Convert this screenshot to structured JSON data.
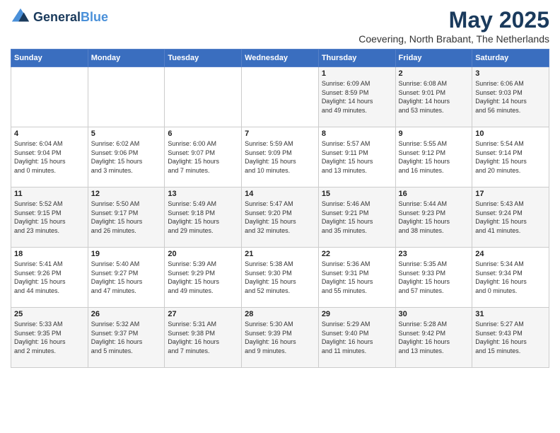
{
  "header": {
    "logo_general": "General",
    "logo_blue": "Blue",
    "month_year": "May 2025",
    "location": "Coevering, North Brabant, The Netherlands"
  },
  "weekdays": [
    "Sunday",
    "Monday",
    "Tuesday",
    "Wednesday",
    "Thursday",
    "Friday",
    "Saturday"
  ],
  "weeks": [
    [
      {
        "day": "",
        "info": ""
      },
      {
        "day": "",
        "info": ""
      },
      {
        "day": "",
        "info": ""
      },
      {
        "day": "",
        "info": ""
      },
      {
        "day": "1",
        "info": "Sunrise: 6:09 AM\nSunset: 8:59 PM\nDaylight: 14 hours\nand 49 minutes."
      },
      {
        "day": "2",
        "info": "Sunrise: 6:08 AM\nSunset: 9:01 PM\nDaylight: 14 hours\nand 53 minutes."
      },
      {
        "day": "3",
        "info": "Sunrise: 6:06 AM\nSunset: 9:03 PM\nDaylight: 14 hours\nand 56 minutes."
      }
    ],
    [
      {
        "day": "4",
        "info": "Sunrise: 6:04 AM\nSunset: 9:04 PM\nDaylight: 15 hours\nand 0 minutes."
      },
      {
        "day": "5",
        "info": "Sunrise: 6:02 AM\nSunset: 9:06 PM\nDaylight: 15 hours\nand 3 minutes."
      },
      {
        "day": "6",
        "info": "Sunrise: 6:00 AM\nSunset: 9:07 PM\nDaylight: 15 hours\nand 7 minutes."
      },
      {
        "day": "7",
        "info": "Sunrise: 5:59 AM\nSunset: 9:09 PM\nDaylight: 15 hours\nand 10 minutes."
      },
      {
        "day": "8",
        "info": "Sunrise: 5:57 AM\nSunset: 9:11 PM\nDaylight: 15 hours\nand 13 minutes."
      },
      {
        "day": "9",
        "info": "Sunrise: 5:55 AM\nSunset: 9:12 PM\nDaylight: 15 hours\nand 16 minutes."
      },
      {
        "day": "10",
        "info": "Sunrise: 5:54 AM\nSunset: 9:14 PM\nDaylight: 15 hours\nand 20 minutes."
      }
    ],
    [
      {
        "day": "11",
        "info": "Sunrise: 5:52 AM\nSunset: 9:15 PM\nDaylight: 15 hours\nand 23 minutes."
      },
      {
        "day": "12",
        "info": "Sunrise: 5:50 AM\nSunset: 9:17 PM\nDaylight: 15 hours\nand 26 minutes."
      },
      {
        "day": "13",
        "info": "Sunrise: 5:49 AM\nSunset: 9:18 PM\nDaylight: 15 hours\nand 29 minutes."
      },
      {
        "day": "14",
        "info": "Sunrise: 5:47 AM\nSunset: 9:20 PM\nDaylight: 15 hours\nand 32 minutes."
      },
      {
        "day": "15",
        "info": "Sunrise: 5:46 AM\nSunset: 9:21 PM\nDaylight: 15 hours\nand 35 minutes."
      },
      {
        "day": "16",
        "info": "Sunrise: 5:44 AM\nSunset: 9:23 PM\nDaylight: 15 hours\nand 38 minutes."
      },
      {
        "day": "17",
        "info": "Sunrise: 5:43 AM\nSunset: 9:24 PM\nDaylight: 15 hours\nand 41 minutes."
      }
    ],
    [
      {
        "day": "18",
        "info": "Sunrise: 5:41 AM\nSunset: 9:26 PM\nDaylight: 15 hours\nand 44 minutes."
      },
      {
        "day": "19",
        "info": "Sunrise: 5:40 AM\nSunset: 9:27 PM\nDaylight: 15 hours\nand 47 minutes."
      },
      {
        "day": "20",
        "info": "Sunrise: 5:39 AM\nSunset: 9:29 PM\nDaylight: 15 hours\nand 49 minutes."
      },
      {
        "day": "21",
        "info": "Sunrise: 5:38 AM\nSunset: 9:30 PM\nDaylight: 15 hours\nand 52 minutes."
      },
      {
        "day": "22",
        "info": "Sunrise: 5:36 AM\nSunset: 9:31 PM\nDaylight: 15 hours\nand 55 minutes."
      },
      {
        "day": "23",
        "info": "Sunrise: 5:35 AM\nSunset: 9:33 PM\nDaylight: 15 hours\nand 57 minutes."
      },
      {
        "day": "24",
        "info": "Sunrise: 5:34 AM\nSunset: 9:34 PM\nDaylight: 16 hours\nand 0 minutes."
      }
    ],
    [
      {
        "day": "25",
        "info": "Sunrise: 5:33 AM\nSunset: 9:35 PM\nDaylight: 16 hours\nand 2 minutes."
      },
      {
        "day": "26",
        "info": "Sunrise: 5:32 AM\nSunset: 9:37 PM\nDaylight: 16 hours\nand 5 minutes."
      },
      {
        "day": "27",
        "info": "Sunrise: 5:31 AM\nSunset: 9:38 PM\nDaylight: 16 hours\nand 7 minutes."
      },
      {
        "day": "28",
        "info": "Sunrise: 5:30 AM\nSunset: 9:39 PM\nDaylight: 16 hours\nand 9 minutes."
      },
      {
        "day": "29",
        "info": "Sunrise: 5:29 AM\nSunset: 9:40 PM\nDaylight: 16 hours\nand 11 minutes."
      },
      {
        "day": "30",
        "info": "Sunrise: 5:28 AM\nSunset: 9:42 PM\nDaylight: 16 hours\nand 13 minutes."
      },
      {
        "day": "31",
        "info": "Sunrise: 5:27 AM\nSunset: 9:43 PM\nDaylight: 16 hours\nand 15 minutes."
      }
    ]
  ]
}
